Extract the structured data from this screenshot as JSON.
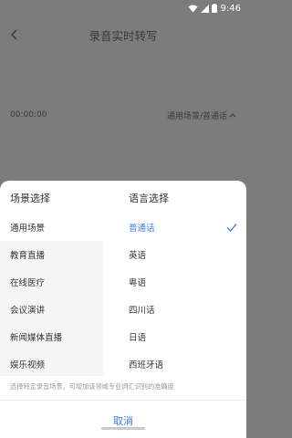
{
  "status_bar": {
    "time": "9:46"
  },
  "header": {
    "title": "录音实时转写"
  },
  "recording": {
    "duration": "00:00:00",
    "mode_label": "通用场景/普通话"
  },
  "sheet": {
    "scene_header": "场景选择",
    "language_header": "语言选择",
    "scenes": [
      {
        "label": "通用场景",
        "selected": true
      },
      {
        "label": "教育直播",
        "selected": false
      },
      {
        "label": "在线医疗",
        "selected": false
      },
      {
        "label": "会议演讲",
        "selected": false
      },
      {
        "label": "新闻媒体直播",
        "selected": false
      },
      {
        "label": "娱乐视频",
        "selected": false
      }
    ],
    "languages": [
      {
        "label": "普通话",
        "selected": true
      },
      {
        "label": "英语",
        "selected": false
      },
      {
        "label": "粤语",
        "selected": false
      },
      {
        "label": "四川话",
        "selected": false
      },
      {
        "label": "日语",
        "selected": false
      },
      {
        "label": "西班牙语",
        "selected": false
      }
    ],
    "hint": "选择特定录音场景，可增加该领域专业词汇识别的准确度",
    "cancel_label": "取消"
  },
  "colors": {
    "accent": "#3b7df0",
    "overlay": "#7c7c7c"
  }
}
